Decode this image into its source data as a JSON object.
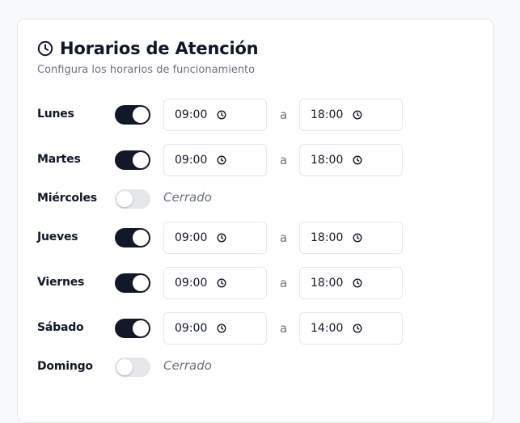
{
  "header": {
    "title": "Horarios de Atención",
    "subtitle": "Configura los horarios de funcionamiento",
    "icon": "clock-icon"
  },
  "separator": "a",
  "closed_label": "Cerrado",
  "colors": {
    "toggle_on": "#111827",
    "toggle_off": "#e5e7eb",
    "border": "#e5e7eb"
  },
  "days": [
    {
      "name": "Lunes",
      "enabled": true,
      "start": "09:00",
      "end": "18:00"
    },
    {
      "name": "Martes",
      "enabled": true,
      "start": "09:00",
      "end": "18:00"
    },
    {
      "name": "Miércoles",
      "enabled": false
    },
    {
      "name": "Jueves",
      "enabled": true,
      "start": "09:00",
      "end": "18:00"
    },
    {
      "name": "Viernes",
      "enabled": true,
      "start": "09:00",
      "end": "18:00"
    },
    {
      "name": "Sábado",
      "enabled": true,
      "start": "09:00",
      "end": "14:00"
    },
    {
      "name": "Domingo",
      "enabled": false
    }
  ]
}
